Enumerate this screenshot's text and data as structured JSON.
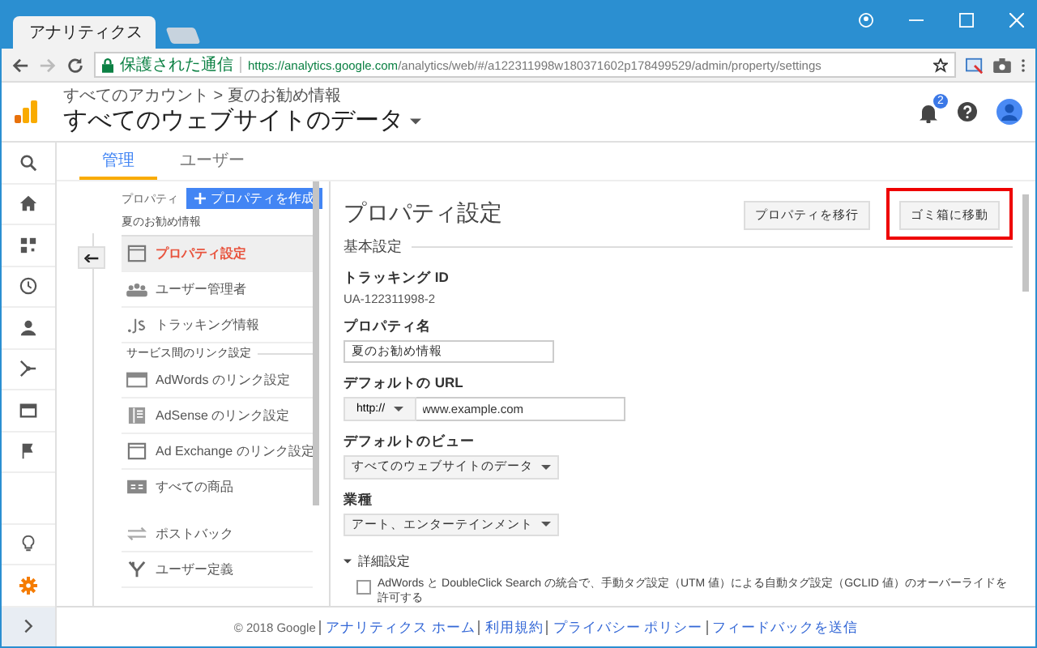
{
  "browser": {
    "tab_title": "アナリティクス",
    "secure_label": "保護された通信",
    "url_host": "https://analytics.google.com",
    "url_path": "/analytics/web/#/a122311998w180371602p178499529/admin/property/settings"
  },
  "header": {
    "breadcrumb": "すべてのアカウント > 夏のお勧め情報",
    "title": "すべてのウェブサイトのデータ",
    "notification_count": "2"
  },
  "rail": [
    {
      "kind": "search",
      "selected": false
    },
    {
      "kind": "home",
      "selected": false
    },
    {
      "kind": "dashboard",
      "selected": false
    },
    {
      "kind": "clock",
      "selected": false
    },
    {
      "kind": "person",
      "selected": false
    },
    {
      "kind": "flow",
      "selected": false
    },
    {
      "kind": "window",
      "selected": false
    },
    {
      "kind": "flag",
      "selected": false
    },
    {
      "kind": "bulb",
      "selected": false
    },
    {
      "kind": "gear",
      "selected": true
    },
    {
      "kind": "expand",
      "selected": false
    }
  ],
  "tabs": [
    {
      "label": "管理",
      "selected": true
    },
    {
      "label": "ユーザー",
      "selected": false
    }
  ],
  "property_panel": {
    "label": "プロパティ",
    "create_button": "プロパティを作成",
    "property_name": "夏のお勧め情報",
    "items": [
      {
        "kind": "panel",
        "label": "プロパティ設定",
        "selected": true
      },
      {
        "kind": "users",
        "label": "ユーザー管理者",
        "selected": false
      },
      {
        "kind": "js",
        "label": "トラッキング情報",
        "selected": false
      },
      {
        "kind": "section",
        "label": "サービス間のリンク設定"
      },
      {
        "kind": "adwords",
        "label": "AdWords のリンク設定",
        "selected": false
      },
      {
        "kind": "adsense",
        "label": "AdSense のリンク設定",
        "selected": false
      },
      {
        "kind": "panel",
        "label": "Ad Exchange のリンク設定",
        "selected": false
      },
      {
        "kind": "products",
        "label": "すべての商品",
        "selected": false
      },
      {
        "kind": "postback",
        "label": "ポストバック",
        "selected": false
      },
      {
        "kind": "custom",
        "label": "ユーザー定義",
        "selected": false
      }
    ]
  },
  "settings": {
    "heading": "プロパティ設定",
    "buttons": [
      {
        "label": "プロパティを移行",
        "highlighted": false
      },
      {
        "label": "ゴミ箱に移動",
        "highlighted": true
      }
    ],
    "section": "基本設定",
    "tracking_id_label": "トラッキング ID",
    "tracking_id": "UA-122311998-2",
    "property_name_label": "プロパティ名",
    "property_name": "夏のお勧め情報",
    "url_label": "デフォルトの URL",
    "url_scheme": "http://",
    "url_value": "www.example.com",
    "view_label": "デフォルトのビュー",
    "view_value": "すべてのウェブサイトのデータ",
    "industry_label": "業種",
    "industry_value": "アート、エンターテインメント",
    "advanced_label": "詳細設定",
    "advanced_expanded": true,
    "override_label": "AdWords と DoubleClick Search の統合で、手動タグ設定（UTM 値）による自動タグ設定（GCLID 値）のオーバーライドを許可する",
    "override_checked": false
  },
  "footer": {
    "copyright": "© 2018 Google",
    "links": [
      "アナリティクス ホーム",
      "利用規約",
      "プライバシー ポリシー",
      "フィードバックを送信"
    ]
  }
}
